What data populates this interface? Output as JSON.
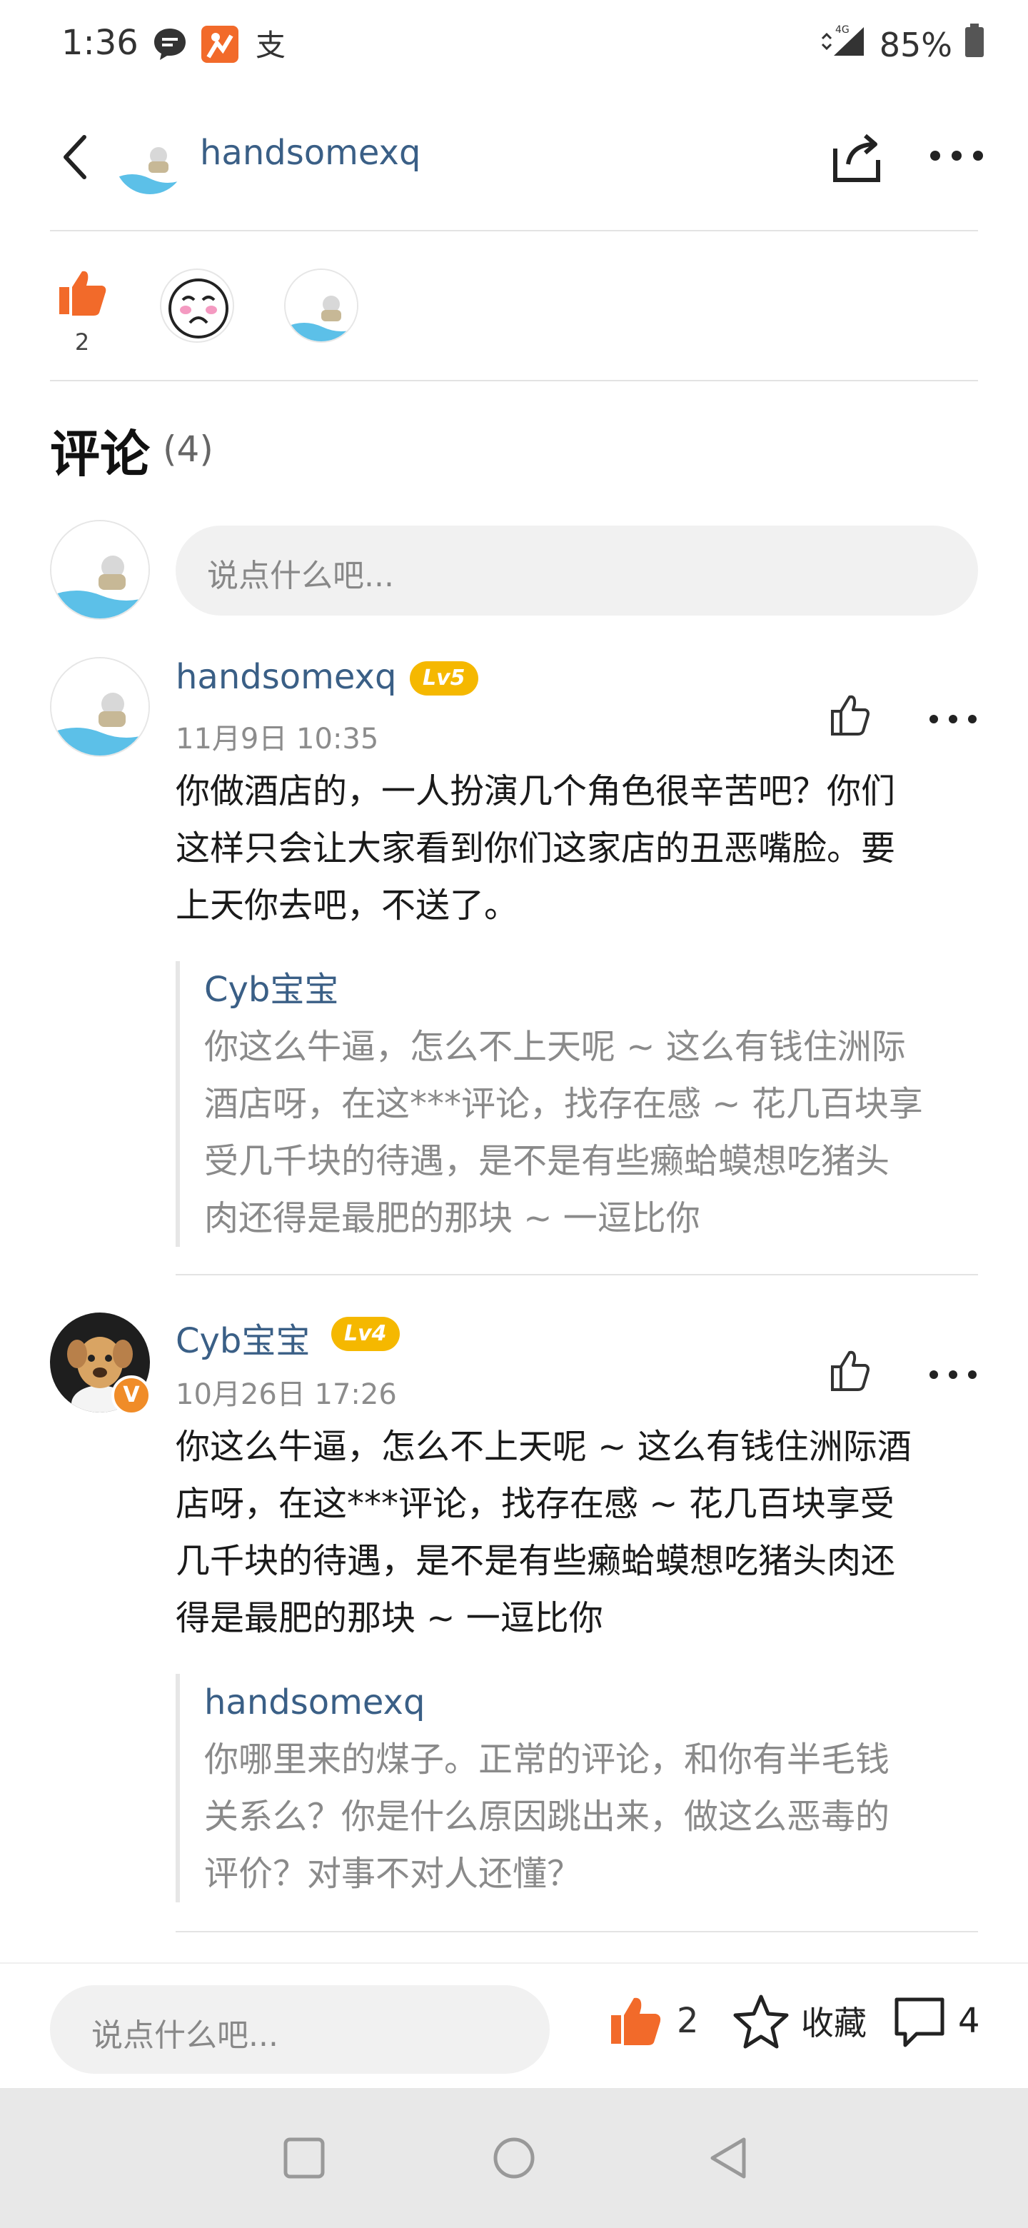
{
  "status_bar": {
    "time": "1:36",
    "network": "4G",
    "battery": "85%",
    "icons": [
      "message-icon",
      "app-orange-icon",
      "alipay-icon"
    ]
  },
  "header": {
    "username": "handsomexq",
    "back_icon": "back-arrow-icon",
    "share_icon": "share-icon",
    "more_icon": "more-icon"
  },
  "likes": {
    "count": "2",
    "icon": "thumbs-up-icon"
  },
  "comments_section": {
    "title": "评论",
    "count": "(4)",
    "input_placeholder": "说点什么吧..."
  },
  "comments": [
    {
      "name": "handsomexq",
      "level": "Lv5",
      "time": "11月9日 10:35",
      "text_lines": [
        "你做酒店的，一人扮演几个角色很辛苦吧？你们",
        "这样只会让大家看到你们这家店的丑恶嘴脸。要",
        "上天你去吧，不送了。"
      ],
      "reply": {
        "name": "Cyb宝宝",
        "text_lines": [
          "你这么牛逼，怎么不上天呢 ~ 这么有钱住洲际",
          "酒店呀，在这***评论，找存在感 ~ 花几百块享",
          "受几千块的待遇，是不是有些癞蛤蟆想吃猪头",
          "肉还得是最肥的那块 ~ 一逗比你"
        ]
      }
    },
    {
      "name": "Cyb宝宝",
      "level": "Lv4",
      "verified": "V",
      "time": "10月26日 17:26",
      "text_lines": [
        "你这么牛逼，怎么不上天呢 ~ 这么有钱住洲际酒",
        "店呀，在这***评论，找存在感 ~ 花几百块享受",
        "几千块的待遇，是不是有些癞蛤蟆想吃猪头肉还",
        "得是最肥的那块 ~ 一逗比你"
      ],
      "reply": {
        "name": "handsomexq",
        "text_lines": [
          "你哪里来的煤子。正常的评论，和你有半毛钱",
          "关系么？你是什么原因跳出来，做这么恶毒的",
          "评价？对事不对人还懂？"
        ]
      }
    }
  ],
  "bottom_bar": {
    "input_placeholder": "说点什么吧...",
    "like_count": "2",
    "favorite_label": "收藏",
    "comment_count": "4"
  },
  "colors": {
    "link_blue": "#3a5f86",
    "like_orange": "#f26a2a",
    "level_badge": "#f5b800"
  }
}
